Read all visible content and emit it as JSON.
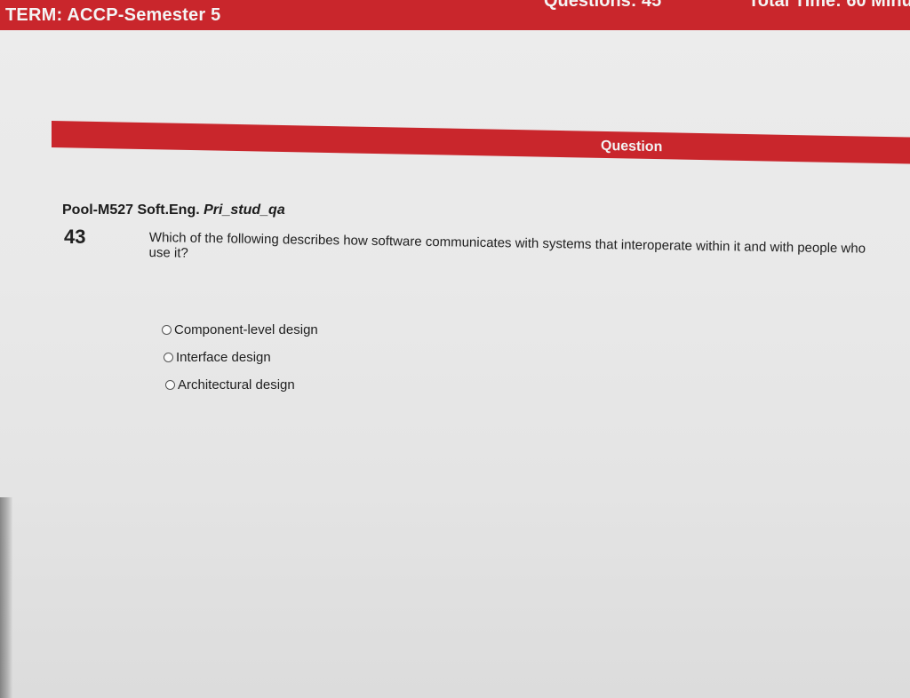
{
  "header": {
    "term": "TERM: ACCP-Semester 5",
    "questions": "Questions: 45",
    "total_time": "Total Time: 60 Minu"
  },
  "question_bar": {
    "label": "Question"
  },
  "question": {
    "pool": "Pool-M527 Soft.Eng.",
    "pool_suffix": "Pri_stud_qa",
    "number": "43",
    "text": "Which of the following describes how software communicates with systems that interoperate within it and with people who use it?",
    "options": [
      {
        "label": "Component-level design",
        "selected": false
      },
      {
        "label": "Interface design",
        "selected": false
      },
      {
        "label": "Architectural design",
        "selected": false
      }
    ]
  },
  "colors": {
    "accent": "#c9262c",
    "background": "#e9e9e9"
  }
}
